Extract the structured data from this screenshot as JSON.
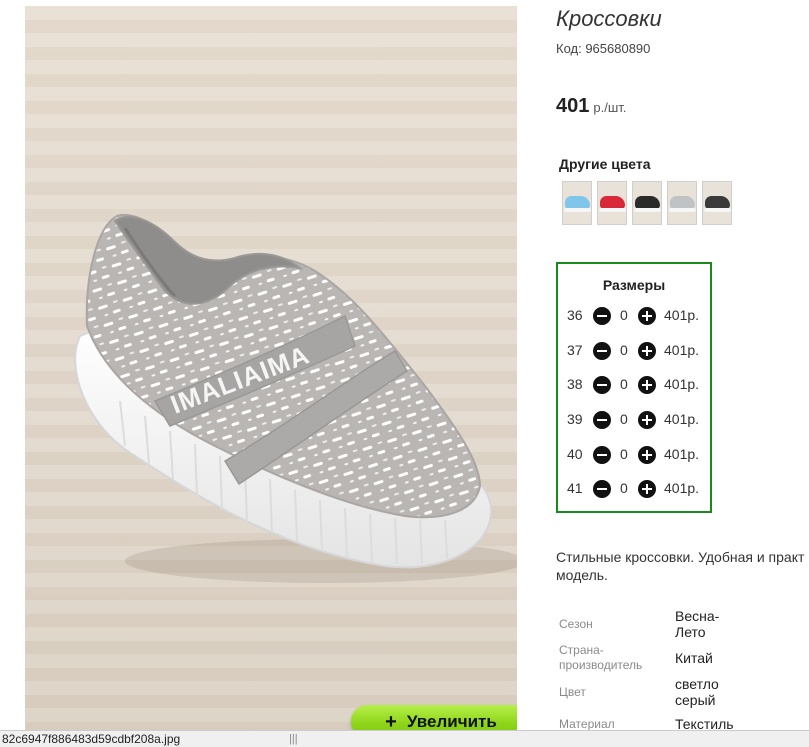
{
  "product": {
    "title": "Кроссовки",
    "code": "Код: 965680890",
    "price_value": "401",
    "price_unit": "р./шт."
  },
  "image": {
    "zoom_label": "Увеличить",
    "zoom_icon": "plus-icon",
    "print_text": "IMALIAIMA"
  },
  "colors": {
    "heading": "Другие цвета",
    "swatches": [
      {
        "name": "light-blue",
        "color": "#7fc6ea"
      },
      {
        "name": "red",
        "color": "#d8283a"
      },
      {
        "name": "black",
        "color": "#2a2a2a"
      },
      {
        "name": "white-grey",
        "color": "#bfc3c6"
      },
      {
        "name": "black-white",
        "color": "#3a3a3a"
      }
    ]
  },
  "sizes": {
    "heading": "Размеры",
    "rows": [
      {
        "size": "36",
        "qty": "0",
        "price": "401р."
      },
      {
        "size": "37",
        "qty": "0",
        "price": "401р."
      },
      {
        "size": "38",
        "qty": "0",
        "price": "401р."
      },
      {
        "size": "39",
        "qty": "0",
        "price": "401р."
      },
      {
        "size": "40",
        "qty": "0",
        "price": "401р."
      },
      {
        "size": "41",
        "qty": "0",
        "price": "401р."
      }
    ],
    "border_color": "#1a8a1a"
  },
  "description": {
    "line1": "Стильные кроссовки. Удобная и практ",
    "line2": "модель."
  },
  "attributes": {
    "season_label": "Сезон",
    "season_value_1": "Весна-",
    "season_value_2": "Лето",
    "country_label_1": "Страна-",
    "country_label_2": "производитель",
    "country_value": "Китай",
    "color_label": "Цвет",
    "color_value_1": "светло",
    "color_value_2": "серый",
    "material_label": "Материал",
    "material_value": "Текстиль"
  },
  "statusbar": {
    "url": "82c6947f886483d59cdbf208a.jpg"
  },
  "accent": {
    "zoom_green": "#8fd61a"
  }
}
